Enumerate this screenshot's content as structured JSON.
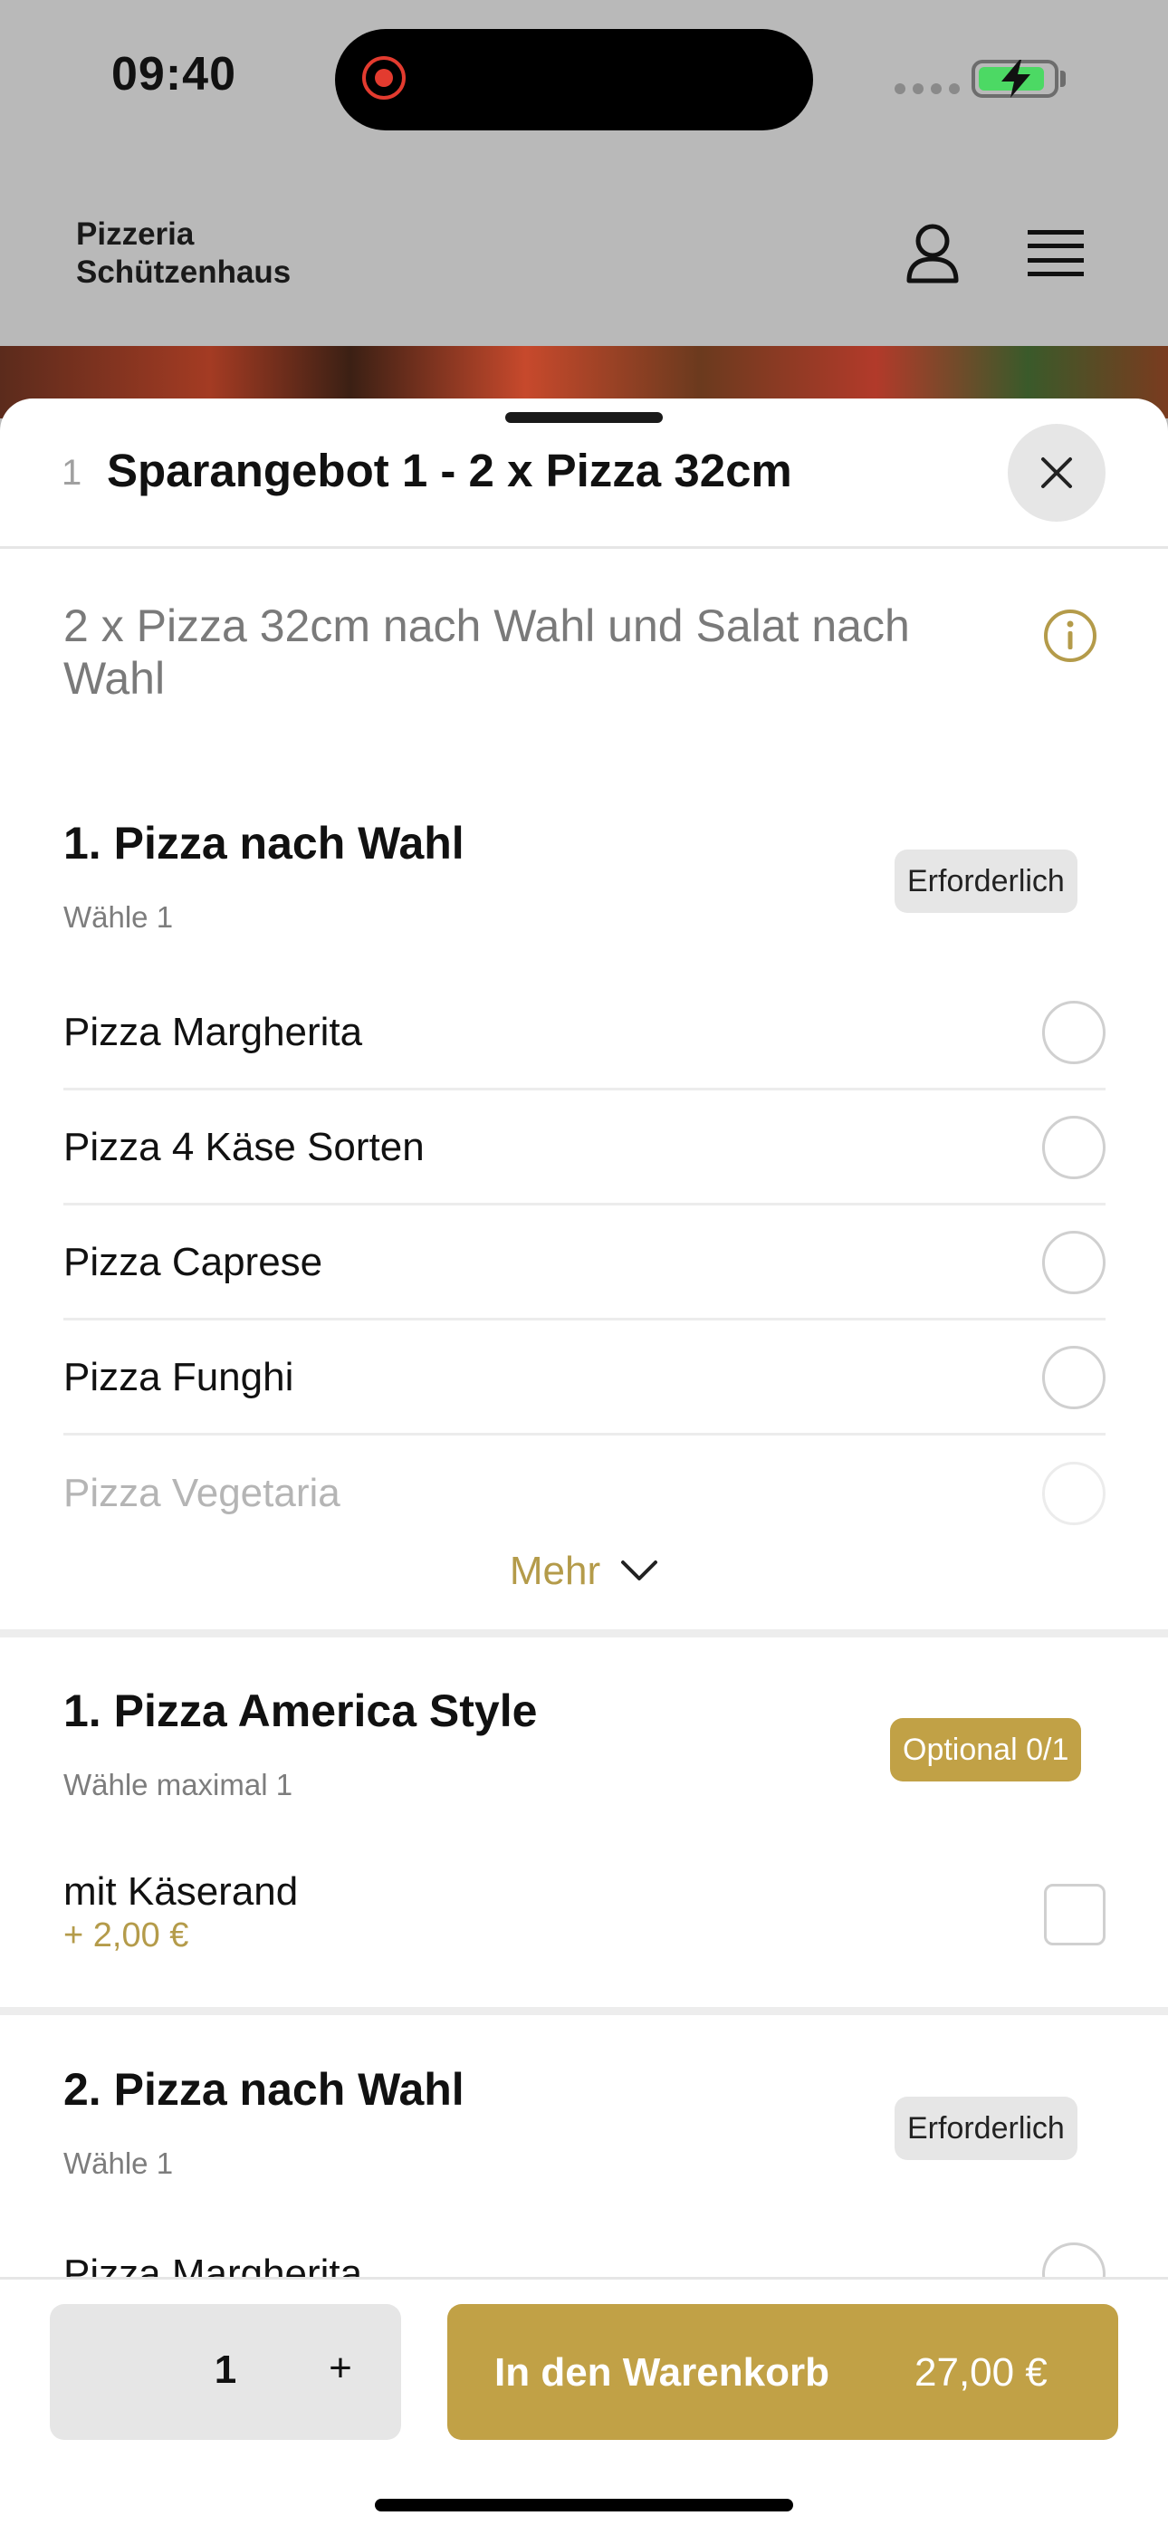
{
  "status_bar": {
    "time": "09:40"
  },
  "header": {
    "brand_line1": "Pizzeria",
    "brand_line2": "Schützenhaus"
  },
  "sheet": {
    "index": "1",
    "title": "Sparangebot 1 - 2 x Pizza 32cm",
    "description": "2 x Pizza 32cm nach Wahl und Salat nach Wahl"
  },
  "sections": [
    {
      "title": "1. Pizza nach Wahl",
      "subtitle": "Wähle 1",
      "badge": "Erforderlich",
      "options": [
        "Pizza Margherita",
        "Pizza 4 Käse Sorten",
        "Pizza Caprese",
        "Pizza Funghi",
        "Pizza Vegetaria"
      ],
      "more_label": "Mehr"
    },
    {
      "title": "1. Pizza America Style",
      "subtitle": "Wähle maximal 1",
      "badge": "Optional 0/1",
      "options": [
        {
          "label": "mit Käserand",
          "price": "+ 2,00 €"
        }
      ]
    },
    {
      "title": "2. Pizza nach Wahl",
      "subtitle": "Wähle 1",
      "badge": "Erforderlich",
      "options": [
        "Pizza Margherita"
      ]
    }
  ],
  "footer": {
    "quantity": "1",
    "plus": "+",
    "cart_label": "In den Warenkorb",
    "cart_price": "27,00 €"
  },
  "colors": {
    "accent": "#c1a146",
    "accent_text": "#b49b4a",
    "overlay": "#b9b9b9"
  }
}
